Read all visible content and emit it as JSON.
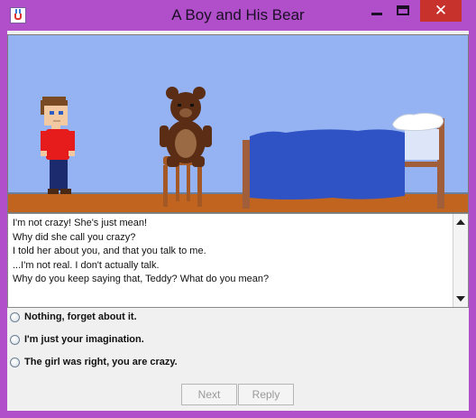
{
  "window": {
    "title": "A Boy and His Bear",
    "close_glyph": "✕"
  },
  "scene": {
    "sky_color": "#95b3f2",
    "floor_color": "#c0641f",
    "wall_line_color": "#6a7fa0",
    "blanket_color": "#2f53c4",
    "bed_frame_color": "#a05e3a",
    "boy_shirt_color": "#e61c1c",
    "boy_pants_color": "#1c2a6e",
    "bear_color": "#5a2d14",
    "chair_color": "#a35826"
  },
  "dialog": {
    "lines": [
      "I'm not crazy! She's just mean!",
      "Why did she call you crazy?",
      "I told her about you, and that you talk to me.",
      "...I'm not real. I don't actually talk.",
      "Why do you keep saying that, Teddy? What do you mean?"
    ]
  },
  "options": [
    "Nothing, forget about it.",
    "I'm just your imagination.",
    "The girl was right, you are crazy."
  ],
  "buttons": {
    "next": "Next",
    "reply": "Reply"
  }
}
